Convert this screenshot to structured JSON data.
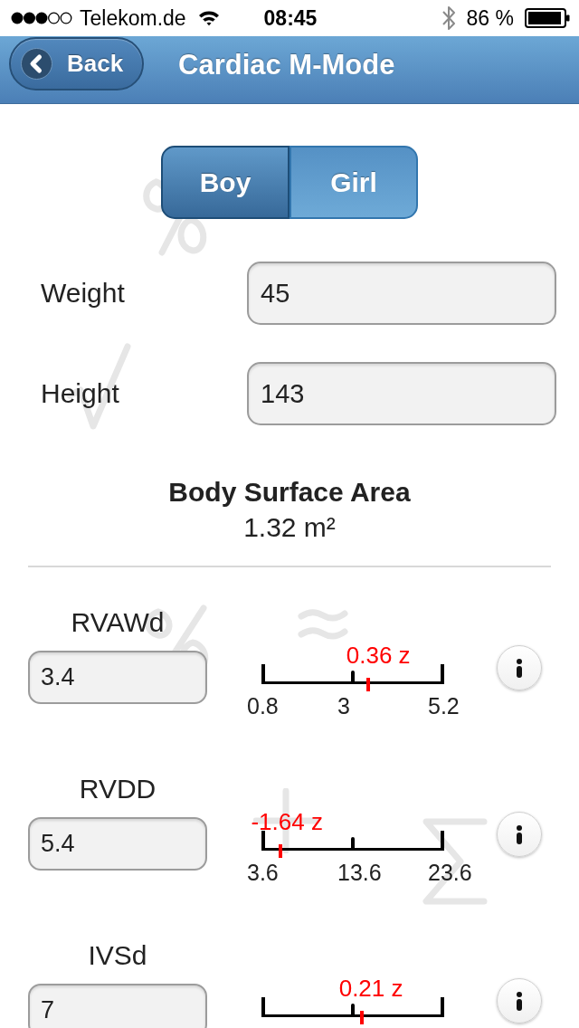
{
  "status_bar": {
    "carrier": "Telekom.de",
    "time": "08:45",
    "battery": "86 %"
  },
  "nav_bar": {
    "back_button": "Back",
    "title": "Cardiac M-Mode"
  },
  "gender_toggle": [
    {
      "label": "Boy",
      "selected": true
    },
    {
      "label": "Girl",
      "selected": false
    }
  ],
  "inputs": [
    {
      "label": "Weight",
      "value": "45"
    },
    {
      "label": "Height",
      "value": "143"
    }
  ],
  "body_surface_area": {
    "title": "Body Surface Area",
    "value": "1.32 m²"
  },
  "measurements": [
    {
      "name": "RVAWd",
      "value": "3.4",
      "z_score": "0.36 z",
      "level": 0.59,
      "ticks": [
        "0.8",
        "3",
        "5.2"
      ]
    },
    {
      "name": "RVDD",
      "value": "5.4",
      "z_score": "-1.64 z",
      "level": 0.09,
      "ticks": [
        "3.6",
        "13.6",
        "23.6"
      ]
    },
    {
      "name": "IVSd",
      "value": "7",
      "z_score": "0.21 z",
      "level": 0.55
    }
  ]
}
